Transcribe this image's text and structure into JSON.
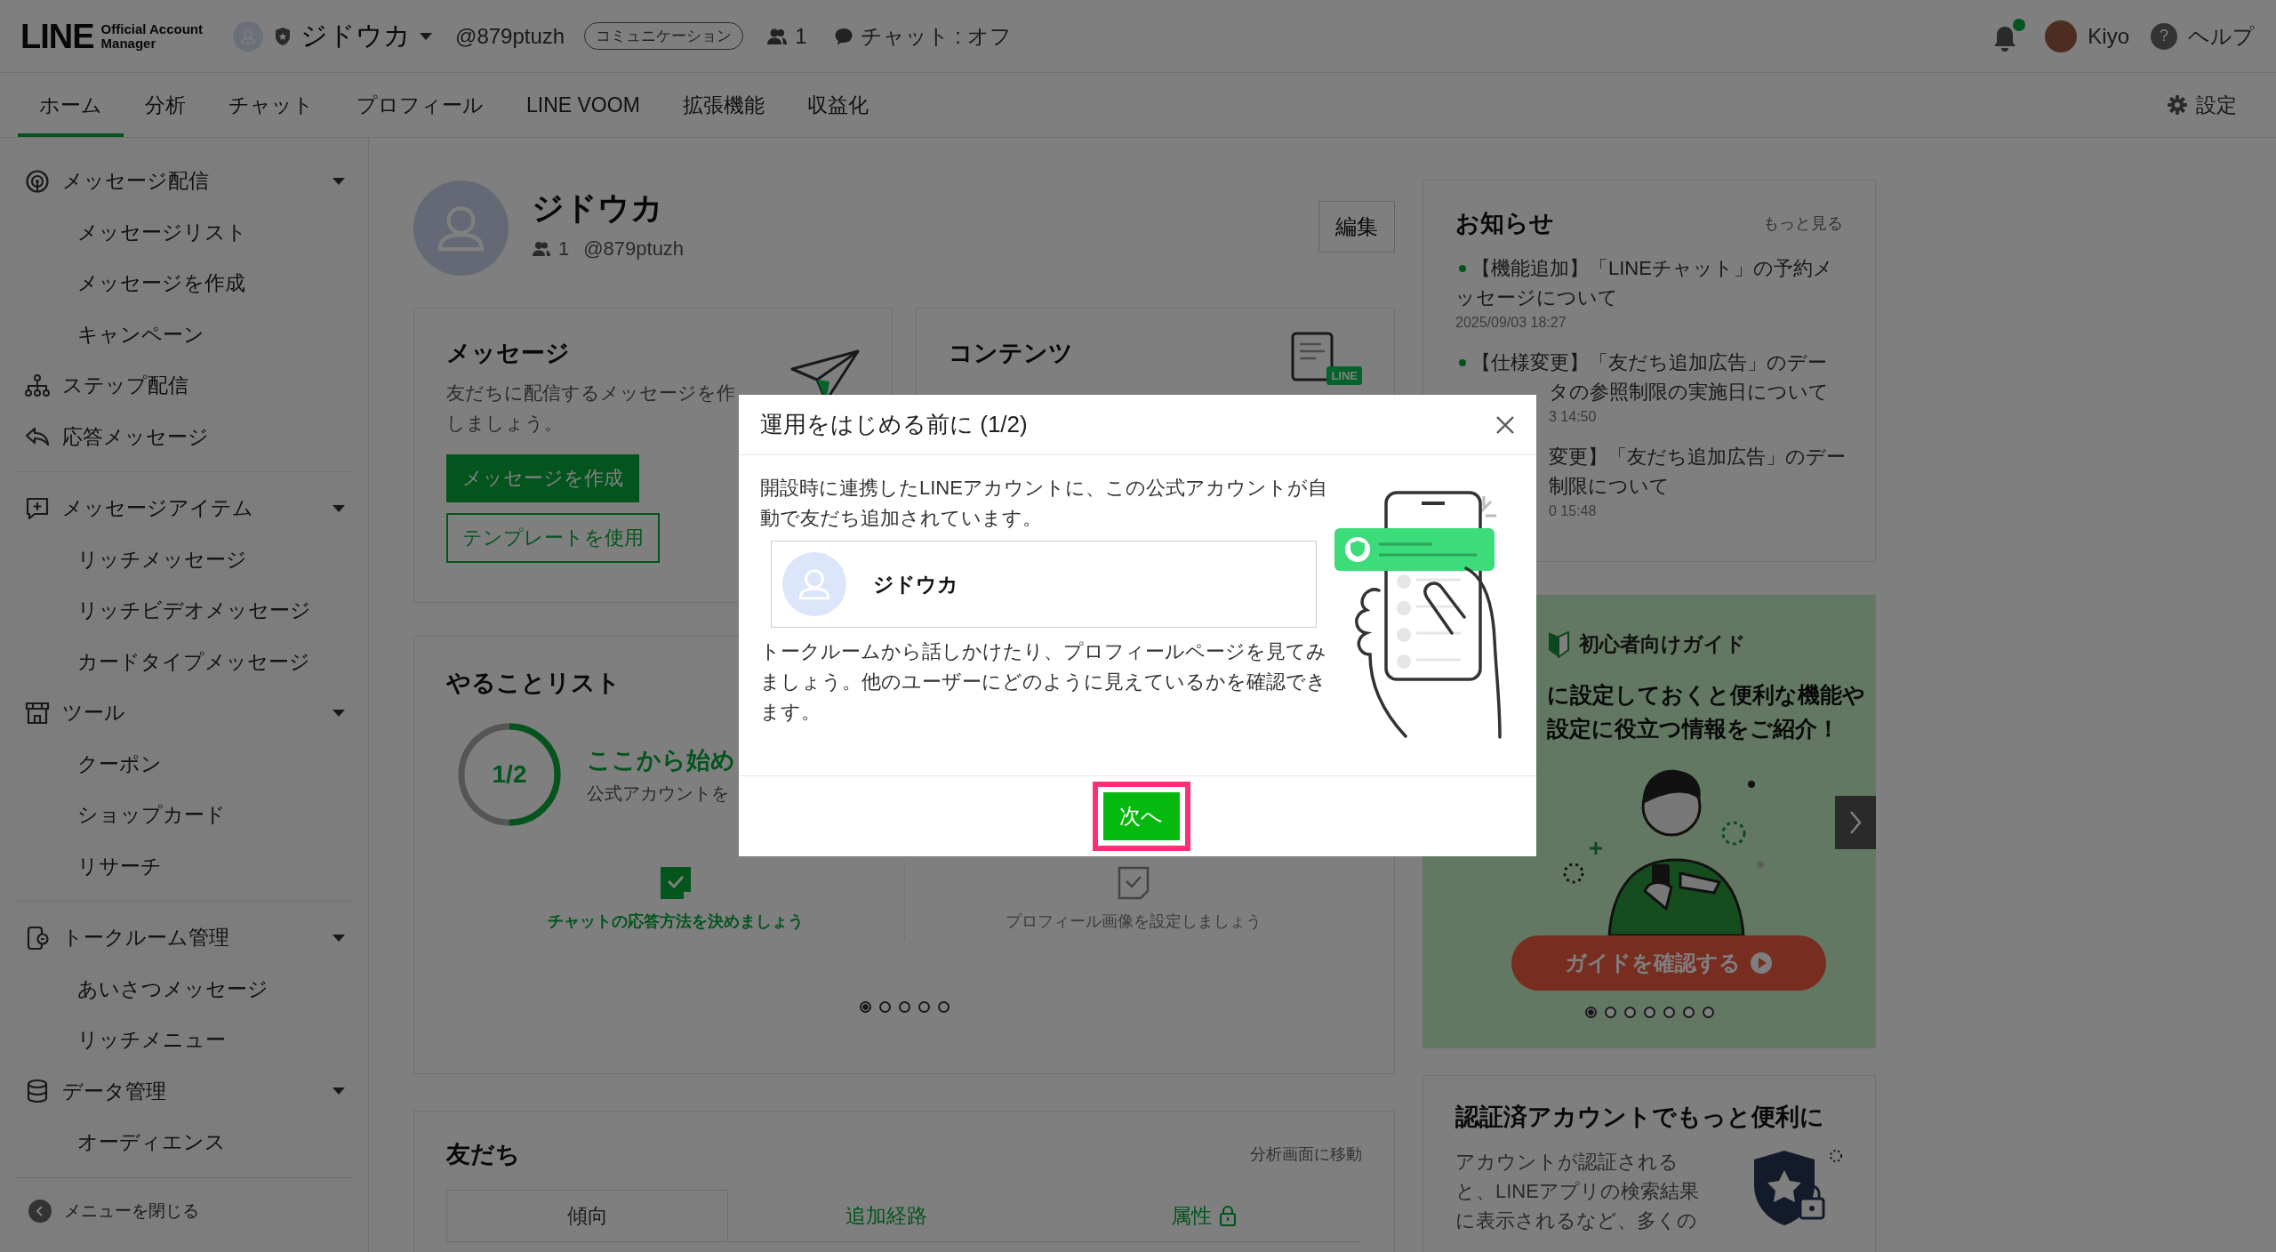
{
  "header": {
    "logo": "LINE",
    "logo_subtitle": [
      "Official Account",
      "Manager"
    ],
    "account_name": "ジドウカ",
    "account_id": "@879ptuzh",
    "plan_badge": "コミュニケーション",
    "friend_count": "1",
    "chat_status": "チャット : オフ",
    "has_notification": true,
    "user_name": "Kiyo",
    "help_icon": "?",
    "help": "ヘルプ"
  },
  "nav": {
    "tabs": [
      {
        "label": "ホーム",
        "selected": true
      },
      {
        "label": "分析",
        "selected": false
      },
      {
        "label": "チャット",
        "selected": false
      },
      {
        "label": "プロフィール",
        "selected": false
      },
      {
        "label": "LINE VOOM",
        "selected": false
      },
      {
        "label": "拡張機能",
        "selected": false
      },
      {
        "label": "収益化",
        "selected": false
      }
    ],
    "settings": "設定"
  },
  "sidebar": {
    "groups": [
      {
        "sections": [
          {
            "label": "メッセージ配信",
            "expanded": true,
            "children": [
              {
                "label": "メッセージリスト"
              },
              {
                "label": "メッセージを作成"
              },
              {
                "label": "キャンペーン"
              }
            ]
          },
          {
            "label": "ステップ配信"
          },
          {
            "label": "応答メッセージ"
          }
        ]
      },
      {
        "sections": [
          {
            "label": "メッセージアイテム",
            "expanded": true,
            "children": [
              {
                "label": "リッチメッセージ"
              },
              {
                "label": "リッチビデオメッセージ"
              },
              {
                "label": "カードタイプメッセージ"
              }
            ]
          },
          {
            "label": "ツール",
            "expanded": true,
            "children": [
              {
                "label": "クーポン"
              },
              {
                "label": "ショップカード"
              },
              {
                "label": "リサーチ"
              }
            ]
          }
        ]
      },
      {
        "sections": [
          {
            "label": "トークルーム管理",
            "expanded": true,
            "children": [
              {
                "label": "あいさつメッセージ"
              },
              {
                "label": "リッチメニュー"
              }
            ]
          },
          {
            "label": "データ管理",
            "expanded": true,
            "children": [
              {
                "label": "オーディエンス"
              }
            ]
          }
        ]
      }
    ],
    "close_menu": "メニューを閉じる"
  },
  "profile": {
    "name": "ジドウカ",
    "friend_count": "1",
    "account_id": "@879ptuzh",
    "edit_button": "編集"
  },
  "message_card": {
    "title": "メッセージ",
    "description_lines": [
      "友だちに配信するメッセージを作",
      "しましょう。"
    ],
    "primary_button": "メッセージを作成",
    "secondary_button": "テンプレートを使用"
  },
  "contents_card": {
    "title": "コンテンツ",
    "icon_label": "LINE"
  },
  "todo": {
    "title": "やることリスト",
    "progress": "1/2",
    "level": 0.5,
    "heading": "ここから始め",
    "subtext": "公式アカウントを",
    "items": [
      {
        "label": "チャットの応答方法を決めましょう",
        "done": true
      },
      {
        "label": "プロフィール画像を設定しましょう",
        "done": false
      }
    ],
    "pages": [
      {
        "selected": true
      },
      {
        "selected": false
      },
      {
        "selected": false
      },
      {
        "selected": false
      },
      {
        "selected": false
      }
    ]
  },
  "friends": {
    "title": "友だち",
    "link": "分析画面に移動",
    "tabs": [
      {
        "label": "傾向",
        "selected": true,
        "locked": false
      },
      {
        "label": "追加経路",
        "selected": false,
        "locked": false
      },
      {
        "label": "属性",
        "selected": false,
        "locked": true
      }
    ]
  },
  "news": {
    "title": "お知らせ",
    "more": "もっと見る",
    "items": [
      {
        "lines": [
          "【機能追加】「LINEチャット」の予約メ",
          "ッセージについて"
        ],
        "date": "2025/09/03 18:27"
      },
      {
        "lines": [
          "【仕様変更】「友だち追加広告」のデー",
          "タの参照制限の実施日について"
        ],
        "date": "3 14:50"
      },
      {
        "lines": [
          "変更】「友だち追加広告」のデー",
          "制限について"
        ],
        "date": "0 15:48"
      }
    ]
  },
  "guide": {
    "title": "初心者向けガイド",
    "headline_lines": [
      "に設定しておくと便利な機能や",
      "設定に役立つ情報をご紹介！"
    ],
    "button": "ガイドを確認する",
    "pages": [
      {
        "selected": true
      },
      {
        "selected": false
      },
      {
        "selected": false
      },
      {
        "selected": false
      },
      {
        "selected": false
      },
      {
        "selected": false
      },
      {
        "selected": false
      }
    ]
  },
  "verify_card": {
    "title": "認証済アカウントでもっと便利に",
    "text": "アカウントが認証されると、LINEアプリの検索結果に表示されるなど、多くの"
  },
  "dialog": {
    "title": "運用をはじめる前に (1/2)",
    "intro": "開設時に連携したLINEアカウントに、この公式アカウントが自動で友だち追加されています。",
    "account_name": "ジドウカ",
    "body": "トークルームから話しかけたり、プロフィールページを見てみましょう。他のユーザーにどのように見えているかを確認できます。",
    "next_button": "次へ"
  }
}
